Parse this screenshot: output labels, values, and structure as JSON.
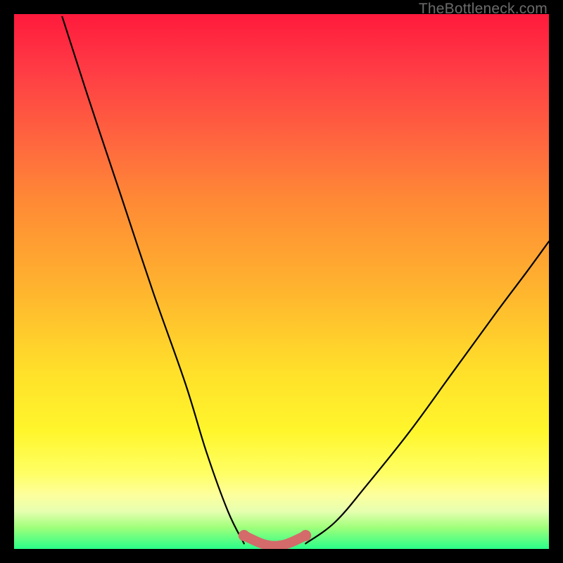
{
  "branding": {
    "watermark": "TheBottleneck.com"
  },
  "chart_data": {
    "type": "line",
    "title": "",
    "xlabel": "",
    "ylabel": "",
    "xlim": [
      0.0,
      1.0
    ],
    "ylim": [
      0.0,
      1.0
    ],
    "grid": false,
    "legend": {
      "show": false
    },
    "series": [
      {
        "name": "left-curve",
        "color": "#000000",
        "x": [
          0.09,
          0.14,
          0.2,
          0.26,
          0.32,
          0.36,
          0.4,
          0.43
        ],
        "y": [
          0.995,
          0.84,
          0.66,
          0.48,
          0.31,
          0.18,
          0.07,
          0.01
        ]
      },
      {
        "name": "right-curve",
        "color": "#000000",
        "x": [
          0.545,
          0.6,
          0.66,
          0.74,
          0.82,
          0.9,
          0.96,
          1.0
        ],
        "y": [
          0.01,
          0.05,
          0.12,
          0.22,
          0.33,
          0.44,
          0.52,
          0.575
        ]
      },
      {
        "name": "bottom-band",
        "color": "#d46a6a",
        "x": [
          0.43,
          0.47,
          0.505,
          0.545
        ],
        "y": [
          0.025,
          0.008,
          0.008,
          0.025
        ]
      }
    ],
    "background_gradient": {
      "direction": "top-to-bottom",
      "stops": [
        {
          "pos": 0.0,
          "color": "#ff1a3c"
        },
        {
          "pos": 0.35,
          "color": "#ff8a35"
        },
        {
          "pos": 0.67,
          "color": "#ffe02a"
        },
        {
          "pos": 0.9,
          "color": "#fdff9e"
        },
        {
          "pos": 1.0,
          "color": "#2aff89"
        }
      ]
    }
  }
}
